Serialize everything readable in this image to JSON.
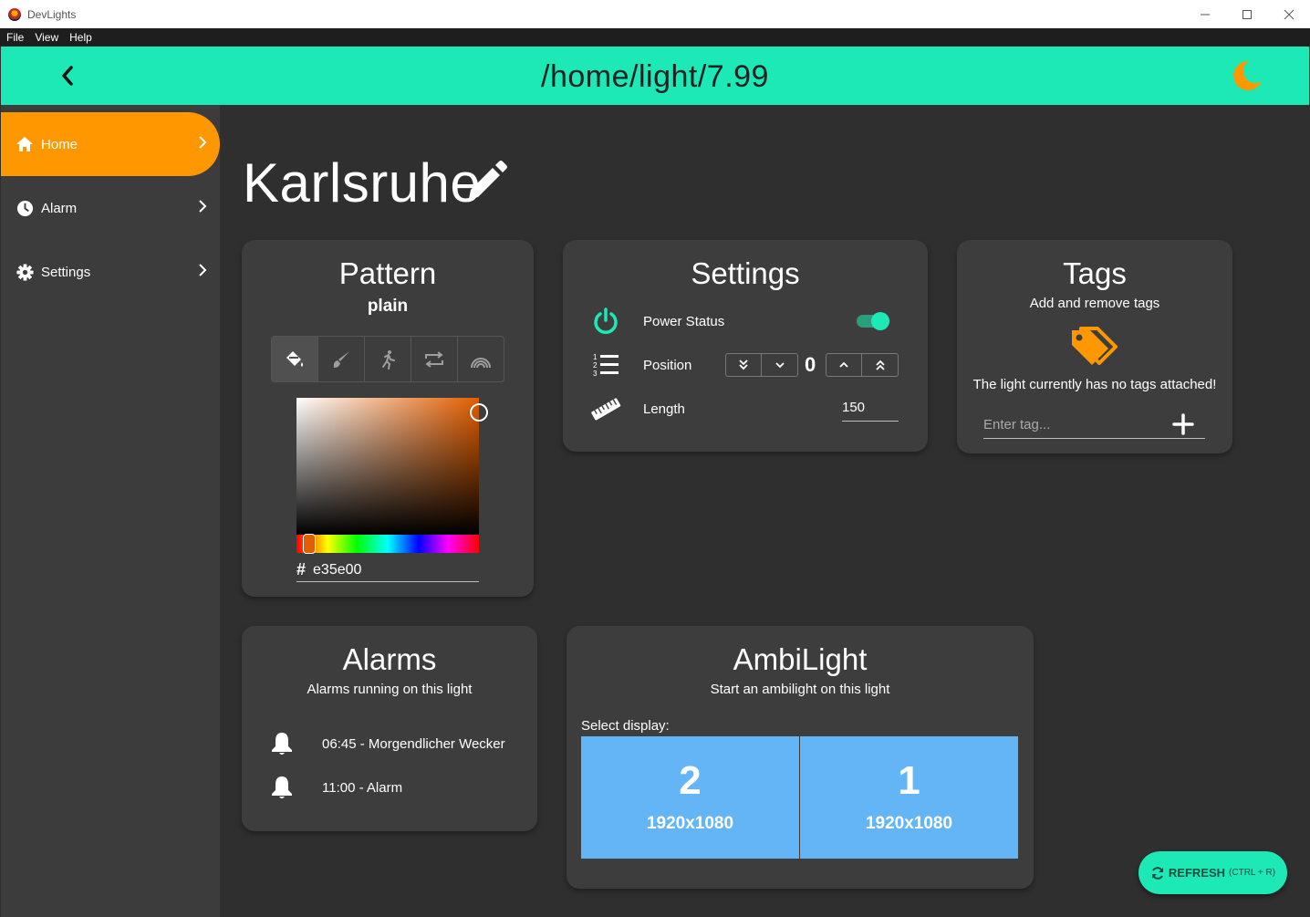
{
  "window": {
    "title": "DevLights",
    "minimize": "—",
    "maximize": "☐",
    "close": "✕"
  },
  "menu": [
    "File",
    "View",
    "Help"
  ],
  "header": {
    "title": "/home/light/7.99",
    "accent": "#1de9b6"
  },
  "sidebar": {
    "items": [
      {
        "label": "Home",
        "active": true
      },
      {
        "label": "Alarm",
        "active": false
      },
      {
        "label": "Settings",
        "active": false
      }
    ],
    "active_color": "#ff9800"
  },
  "page": {
    "title": "Karlsruhe"
  },
  "pattern": {
    "title": "Pattern",
    "subtitle": "plain",
    "tabs": [
      "paint-bucket-icon",
      "brush-icon",
      "running-icon",
      "repeat-icon",
      "rainbow-icon"
    ],
    "hex_symbol": "#",
    "color_hex": "e35e00"
  },
  "settings": {
    "title": "Settings",
    "power_label": "Power Status",
    "power_on": true,
    "position_label": "Position",
    "position_value": "0",
    "length_label": "Length",
    "length_value": "150"
  },
  "tags": {
    "title": "Tags",
    "subtitle": "Add and remove tags",
    "message": "The light currently has no tags attached!",
    "input_placeholder": "Enter tag..."
  },
  "alarms": {
    "title": "Alarms",
    "subtitle": "Alarms running on this light",
    "items": [
      {
        "label": "06:45 - Morgendlicher Wecker"
      },
      {
        "label": "11:00 - Alarm"
      }
    ]
  },
  "ambilight": {
    "title": "AmbiLight",
    "subtitle": "Start an ambilight on this light",
    "select_label": "Select display:",
    "displays": [
      {
        "number": "2",
        "resolution": "1920x1080"
      },
      {
        "number": "1",
        "resolution": "1920x1080"
      }
    ]
  },
  "refresh": {
    "label": "REFRESH",
    "shortcut": "(CTRL + R)"
  }
}
